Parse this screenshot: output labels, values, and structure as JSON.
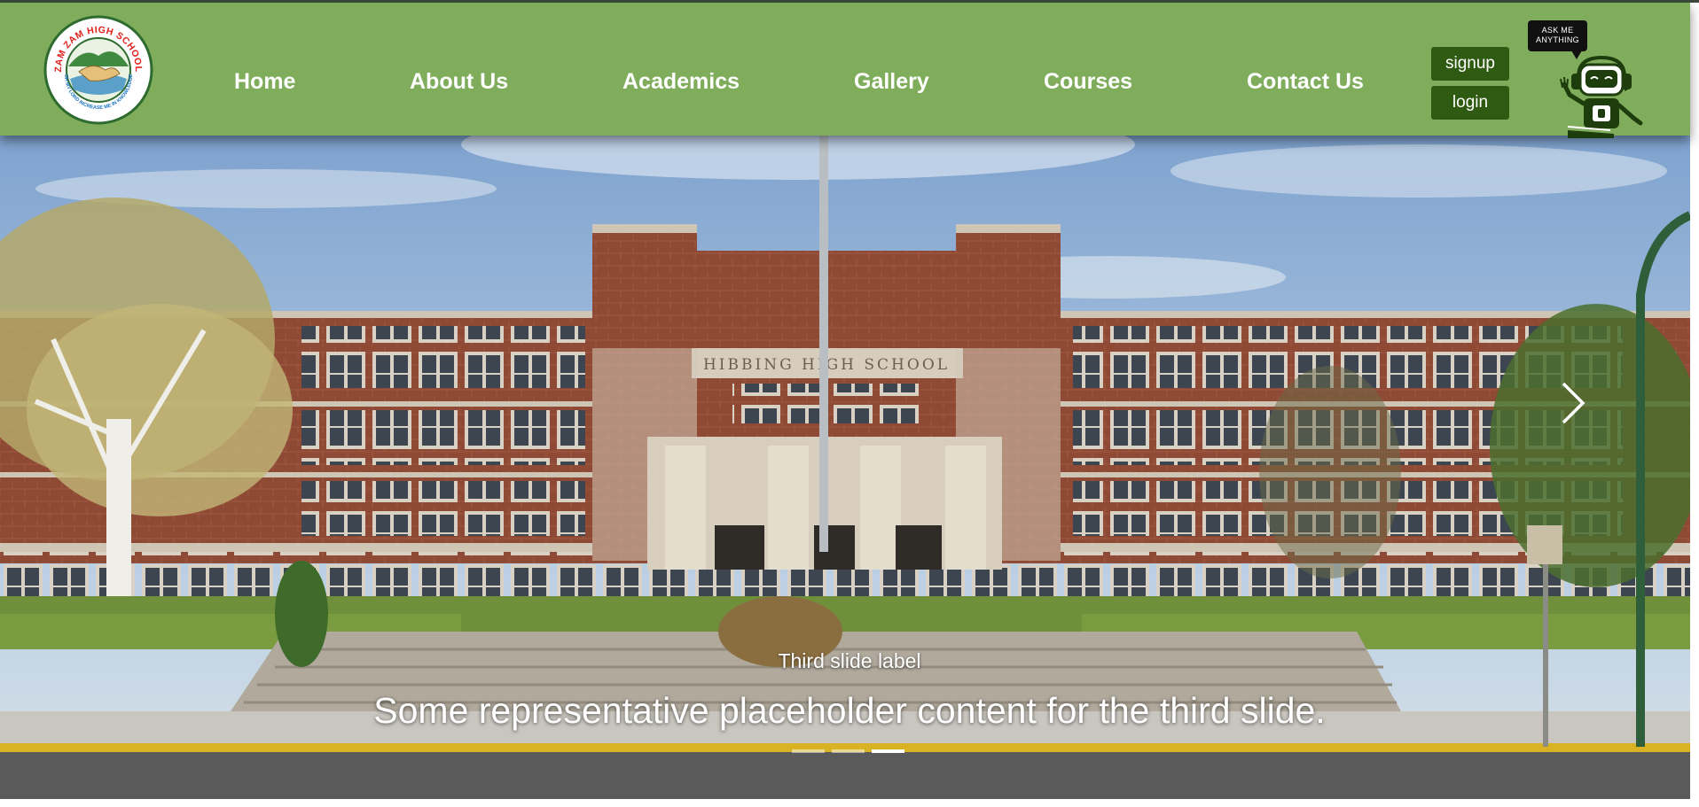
{
  "school": {
    "logo_text": "ZAM ZAM HIGH SCHOOL",
    "logo_motto": "OH MY LORD INCREASE ME IN KNOWLEDGE"
  },
  "nav": {
    "items": [
      {
        "label": "Home"
      },
      {
        "label": "About Us"
      },
      {
        "label": "Academics"
      },
      {
        "label": "Gallery"
      },
      {
        "label": "Courses"
      },
      {
        "label": "Contact Us"
      }
    ],
    "signup_label": "signup",
    "login_label": "login"
  },
  "chatbot": {
    "bubble_line1": "ASK ME",
    "bubble_line2": "ANYTHING",
    "icon": "robot-icon"
  },
  "carousel": {
    "slide_label": "Third slide label",
    "slide_text": "Some representative placeholder content for the third slide.",
    "building_sign": "HIBBING HIGH SCHOOL",
    "slide_count": 3,
    "active_index": 2,
    "next_icon": "chevron-right-icon"
  },
  "colors": {
    "navbar": "#80ad5c",
    "button": "#2f5a12",
    "text": "#ffffff"
  }
}
